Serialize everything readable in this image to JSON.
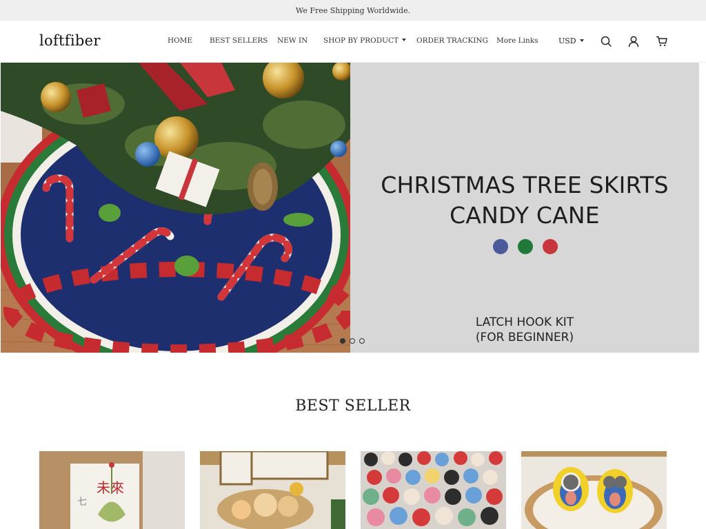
{
  "announcement": "We Free Shipping Worldwide.",
  "header": {
    "logo": "loftfiber",
    "nav": [
      {
        "label": "HOME"
      },
      {
        "label": "BEST SELLERS"
      },
      {
        "label": "NEW IN"
      },
      {
        "label": "SHOP BY PRODUCT",
        "has_dropdown": true
      },
      {
        "label": "ORDER TRACKING"
      },
      {
        "label": "More Links"
      }
    ],
    "currency": "USD",
    "icons": [
      "search-icon",
      "account-icon",
      "cart-icon"
    ]
  },
  "hero": {
    "title_line1": "CHRISTMAS TREE SKIRTS",
    "title_line2": "CANDY CANE",
    "color_options": [
      "#4a5a9a",
      "#1f7a3a",
      "#c8353a"
    ],
    "subtitle_line1": "LATCH HOOK KIT",
    "subtitle_line2": "(FOR BEGINNER)",
    "slides_total": 3,
    "active_slide": 1
  },
  "best_seller": {
    "title": "BEST SELLER",
    "products": [
      {
        "image": "crochet-ornament-photo"
      },
      {
        "image": "crochet-dolls-photo"
      },
      {
        "image": "crochet-keychains-photo"
      },
      {
        "image": "crochet-minion-dolls-photo"
      }
    ]
  }
}
